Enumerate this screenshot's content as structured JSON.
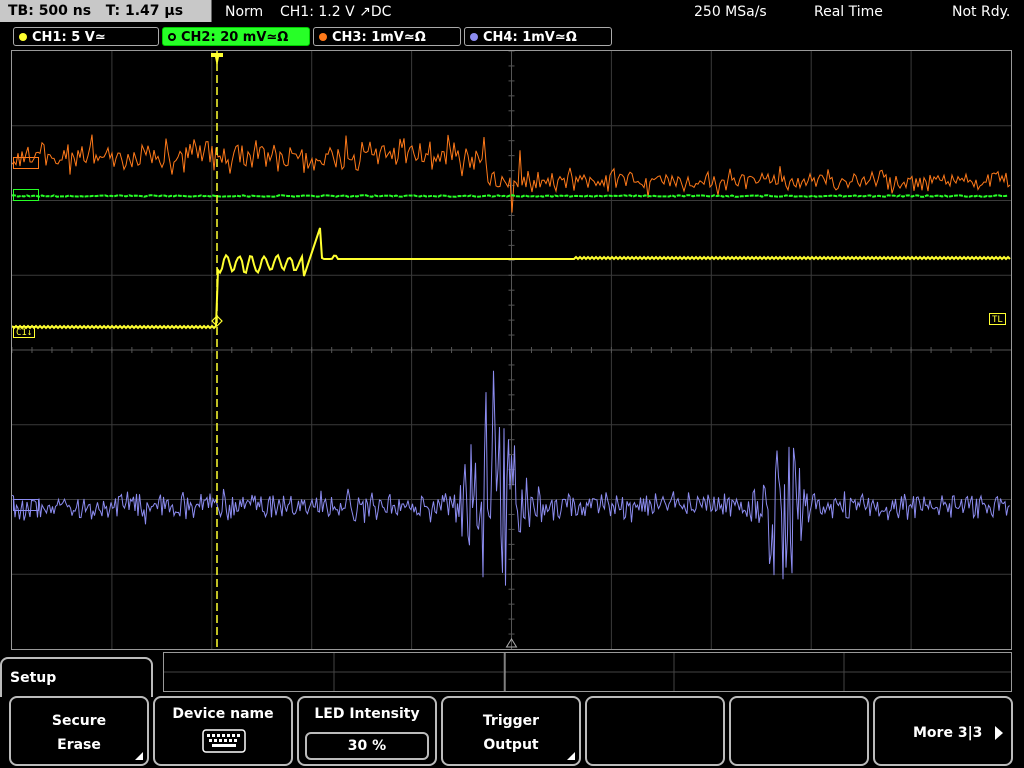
{
  "topbar": {
    "timebase": "TB: 500 ns",
    "trigger_time": "T: 1.47 µs",
    "mode": "Norm",
    "trigger_setting": "CH1: 1.2 V ↗DC",
    "sample_rate": "250 MSa/s",
    "acq_mode": "Real Time",
    "status": "Not Rdy."
  },
  "channels": [
    {
      "label": "CH1: 5 V≃",
      "color": "#ffff30"
    },
    {
      "label": "CH2: 20 mV≃Ω",
      "color": "#27ff27",
      "active": true
    },
    {
      "label": "CH3: 1mV≃Ω",
      "color": "#ff7a1a"
    },
    {
      "label": "CH4: 1mV≃Ω",
      "color": "#8c8cf0"
    }
  ],
  "waveform_colors": {
    "ch1": "#ffff30",
    "ch2": "#27ff27",
    "ch3": "#ff7a1a",
    "ch4": "#8c8cf0"
  },
  "markers": {
    "ch1_ref": "C1",
    "trigger_level": "TL"
  },
  "menu": {
    "title": "Setup",
    "softkeys": [
      {
        "line1": "Secure",
        "line2": "Erase"
      },
      {
        "line1": "Device name",
        "icon": "keyboard-icon"
      },
      {
        "line1": "LED Intensity",
        "value": "30 %"
      },
      {
        "line1": "Trigger",
        "line2": "Output"
      },
      {
        "line1": ""
      },
      {
        "line1": ""
      },
      {
        "line1": "More 3|3"
      }
    ]
  }
}
